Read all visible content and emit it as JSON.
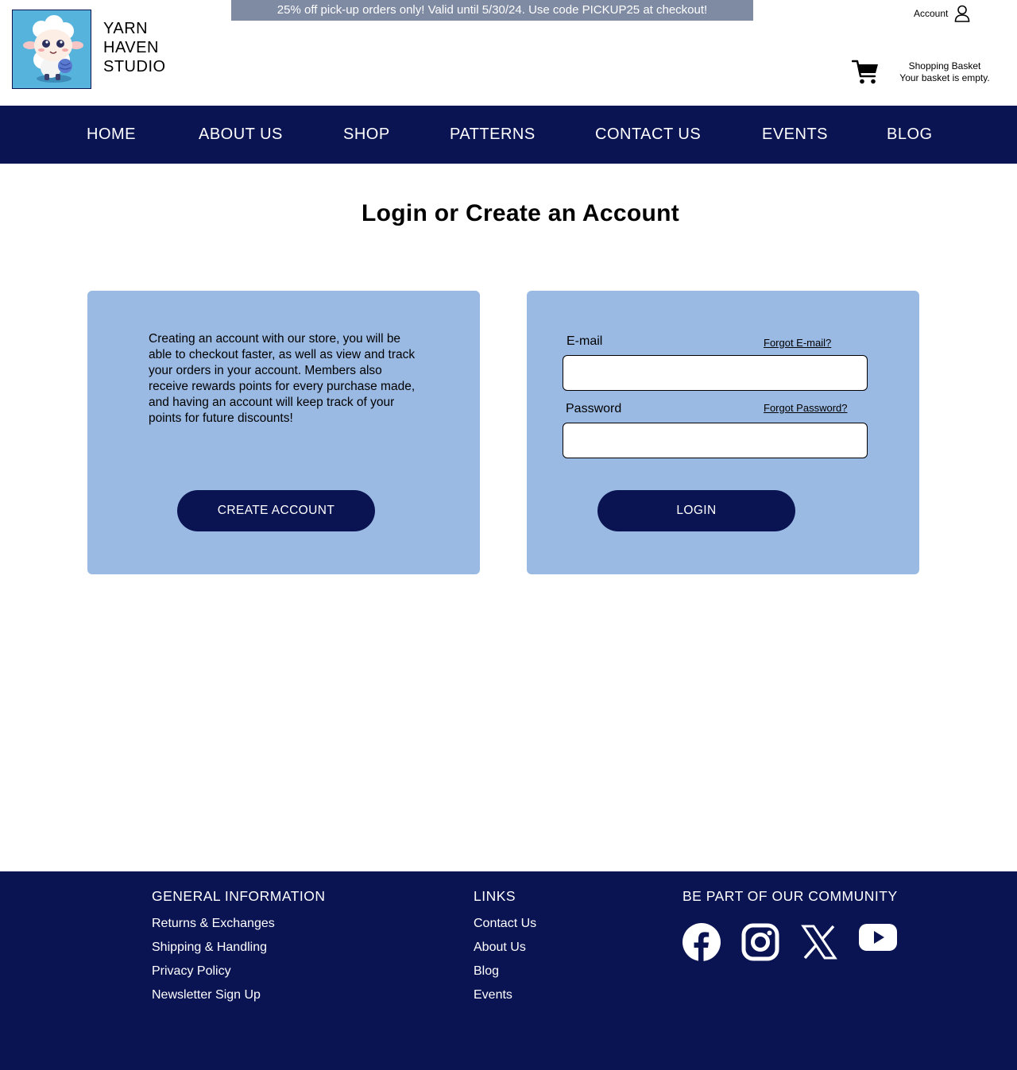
{
  "header": {
    "brand_lines": [
      "YARN",
      "HAVEN",
      "STUDIO"
    ],
    "logo_icon": "sheep-mascot-icon",
    "promo": "25% off pick-up orders only! Valid until 5/30/24. Use code PICKUP25 at checkout!",
    "account_label": "Account",
    "basket_title": "Shopping Basket",
    "basket_status": "Your basket is empty."
  },
  "nav": {
    "items": [
      "HOME",
      "ABOUT US",
      "SHOP",
      "PATTERNS",
      "CONTACT US",
      "EVENTS",
      "BLOG"
    ]
  },
  "main": {
    "title": "Login or Create an Account",
    "create": {
      "description": "Creating an account with our store, you will be able to checkout faster, as well as view and track your orders in your account. Members also receive rewards points for every purchase made, and having an account will keep track of your points for future discounts!",
      "button": "CREATE ACCOUNT"
    },
    "login": {
      "email_label": "E-mail",
      "forgot_email": "Forgot E-mail?",
      "email_value": "",
      "password_label": "Password",
      "forgot_password": "Forgot Password?",
      "password_value": "",
      "button": "LOGIN"
    }
  },
  "footer": {
    "general": {
      "heading": "GENERAL INFORMATION",
      "links": [
        "Returns & Exchanges",
        "Shipping & Handling",
        "Privacy Policy",
        "Newsletter Sign Up"
      ]
    },
    "links": {
      "heading": "LINKS",
      "links": [
        "Contact Us",
        "About Us",
        "Blog",
        "Events"
      ]
    },
    "community": {
      "heading": "BE PART OF OUR COMMUNITY",
      "icons": [
        "facebook-icon",
        "instagram-icon",
        "x-icon",
        "youtube-icon"
      ]
    }
  },
  "colors": {
    "navy": "#0b1453",
    "panel_blue": "#9abae3",
    "promo_grey": "#7f8aa3",
    "logo_bg": "#56b4dc"
  }
}
